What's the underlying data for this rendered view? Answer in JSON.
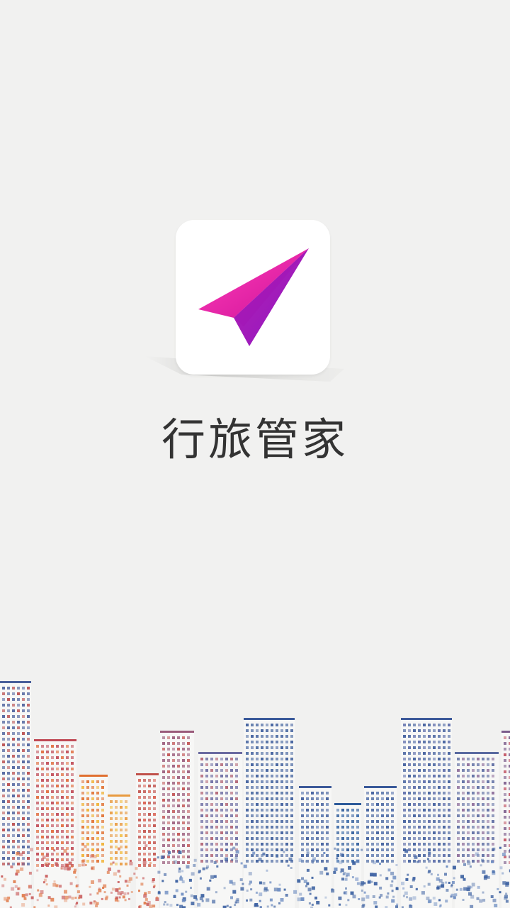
{
  "app": {
    "name": "行旅管家",
    "logo_icon": "paper-plane-arrow-icon",
    "brand_color": "#e0149c"
  },
  "background": {
    "color": "#f1f1f0",
    "illustration": "city-skyline-illustration"
  }
}
